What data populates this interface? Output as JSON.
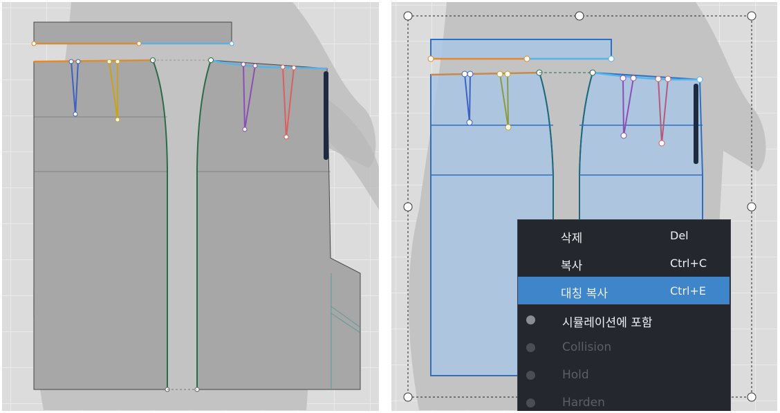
{
  "context_menu": {
    "items": [
      {
        "label": "삭제",
        "shortcut": "Del",
        "highlighted": false
      },
      {
        "label": "복사",
        "shortcut": "Ctrl+C",
        "highlighted": false
      },
      {
        "label": "대칭 복사",
        "shortcut": "Ctrl+E",
        "highlighted": true
      }
    ],
    "toggles": [
      {
        "label": "시뮬레이션에 포함",
        "enabled": true
      },
      {
        "label": "Collision",
        "enabled": false
      },
      {
        "label": "Hold",
        "enabled": false
      },
      {
        "label": "Harden",
        "enabled": false
      }
    ]
  },
  "colors": {
    "canvas_bg": "#dcdcdc",
    "pattern_gray": "#a7a7a7",
    "pattern_selected_blue": "#a9c6e4",
    "selected_outline": "#2f6fbf",
    "menu_bg": "#24272e",
    "menu_highlight": "#3f85c9",
    "waist_orange": "#e08a2c",
    "waist_blue": "#57b3e8",
    "seam_green": "#2a6a4a",
    "dart_blue": "#3a62c4",
    "dart_yellow": "#c9a21a",
    "dart_purple": "#8a4fb3",
    "dart_red": "#d9605c",
    "zipper_navy": "#1e2a40"
  }
}
